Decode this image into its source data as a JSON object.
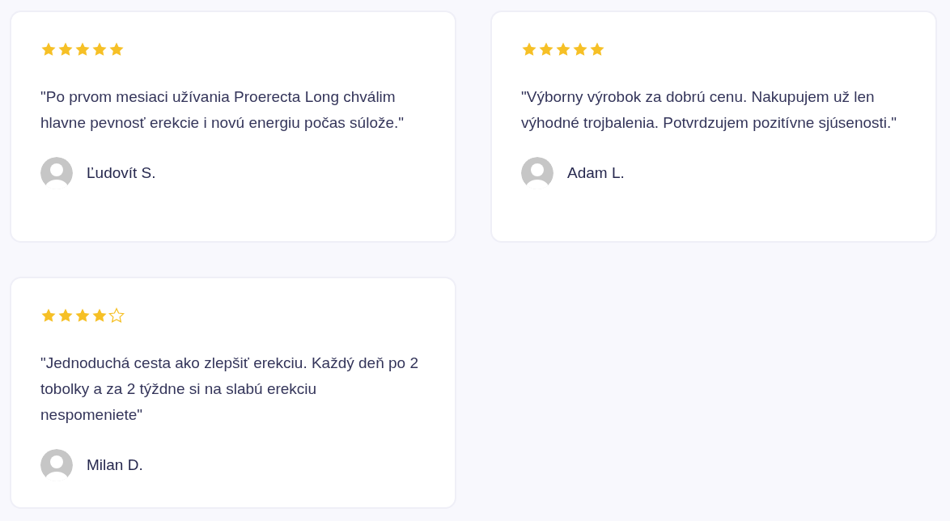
{
  "reviews": [
    {
      "stars": 5,
      "quote": "\"Po prvom mesiaci užívania Proerecta Long chválim hlavne pevnosť erekcie i novú energiu počas súlože.\"",
      "author": "Ľudovít S."
    },
    {
      "stars": 5,
      "quote": "\"Výborny výrobok za dobrú cenu. Nakupujem už len výhodné trojbalenia. Potvrdzujem pozitívne sjúsenosti.\"",
      "author": "Adam L."
    },
    {
      "stars": 4,
      "quote": "\"Jednoduchá cesta ako zlepšiť erekciu. Každý deň po 2 tobolky a za 2 týždne si na slabú erekciu nespomeniete\"",
      "author": "Milan D."
    }
  ]
}
